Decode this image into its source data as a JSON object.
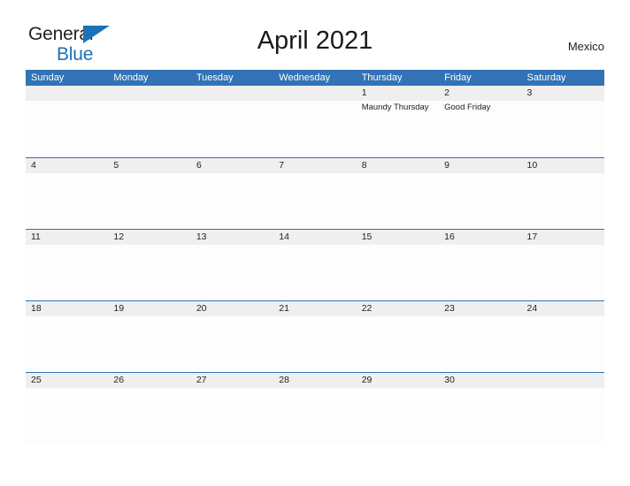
{
  "brand": {
    "name_part1": "General",
    "name_part2": "Blue",
    "accent_color": "#1b72b8"
  },
  "header": {
    "title": "April 2021",
    "country": "Mexico"
  },
  "calendar": {
    "header_bg_color": "#3272b5",
    "date_strip_bg_color": "#efefef",
    "weekdays": [
      "Sunday",
      "Monday",
      "Tuesday",
      "Wednesday",
      "Thursday",
      "Friday",
      "Saturday"
    ],
    "weeks": [
      [
        {
          "day": "",
          "event": ""
        },
        {
          "day": "",
          "event": ""
        },
        {
          "day": "",
          "event": ""
        },
        {
          "day": "",
          "event": ""
        },
        {
          "day": "1",
          "event": "Maundy Thursday"
        },
        {
          "day": "2",
          "event": "Good Friday"
        },
        {
          "day": "3",
          "event": ""
        }
      ],
      [
        {
          "day": "4",
          "event": ""
        },
        {
          "day": "5",
          "event": ""
        },
        {
          "day": "6",
          "event": ""
        },
        {
          "day": "7",
          "event": ""
        },
        {
          "day": "8",
          "event": ""
        },
        {
          "day": "9",
          "event": ""
        },
        {
          "day": "10",
          "event": ""
        }
      ],
      [
        {
          "day": "11",
          "event": ""
        },
        {
          "day": "12",
          "event": ""
        },
        {
          "day": "13",
          "event": ""
        },
        {
          "day": "14",
          "event": ""
        },
        {
          "day": "15",
          "event": ""
        },
        {
          "day": "16",
          "event": ""
        },
        {
          "day": "17",
          "event": ""
        }
      ],
      [
        {
          "day": "18",
          "event": ""
        },
        {
          "day": "19",
          "event": ""
        },
        {
          "day": "20",
          "event": ""
        },
        {
          "day": "21",
          "event": ""
        },
        {
          "day": "22",
          "event": ""
        },
        {
          "day": "23",
          "event": ""
        },
        {
          "day": "24",
          "event": ""
        }
      ],
      [
        {
          "day": "25",
          "event": ""
        },
        {
          "day": "26",
          "event": ""
        },
        {
          "day": "27",
          "event": ""
        },
        {
          "day": "28",
          "event": ""
        },
        {
          "day": "29",
          "event": ""
        },
        {
          "day": "30",
          "event": ""
        },
        {
          "day": "",
          "event": ""
        }
      ]
    ]
  }
}
